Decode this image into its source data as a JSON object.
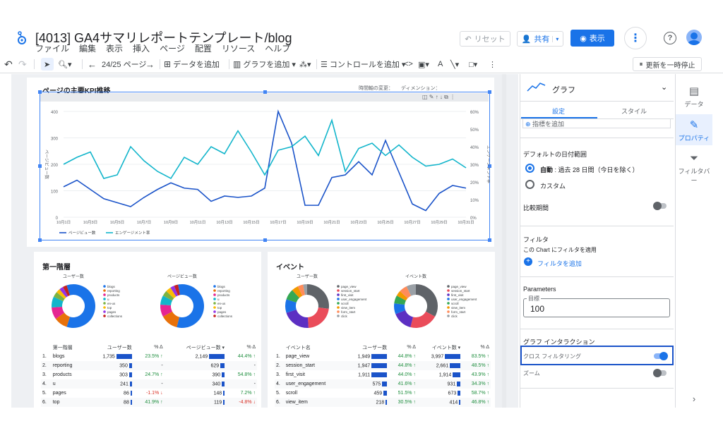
{
  "header": {
    "title": "[4013] GA4サマリレポートテンプレート/blog",
    "menu": [
      "ファイル",
      "編集",
      "表示",
      "挿入",
      "ページ",
      "配置",
      "リソース",
      "ヘルプ"
    ],
    "reset_label": "リセット",
    "share_label": "共有",
    "view_label": "表示"
  },
  "toolbar": {
    "page_indicator": "24/25 ページ",
    "add_data": "データを追加",
    "add_chart": "グラフを追加",
    "control": "コントロールを追加",
    "pause": "更新を一時停止"
  },
  "kpi_chart": {
    "title": "ページの主要KPI推移",
    "date_axis_label": "時間軸の変更：",
    "dimension_label": "ディメンション：",
    "left_axis_label": "ページビュー数",
    "right_axis_label": "エンゲージメント率",
    "legend": [
      "ページビュー数",
      "エンゲージメント率"
    ],
    "colors": {
      "pageviews": "#1a53c9",
      "engagement": "#12b5cb"
    }
  },
  "chart_data": {
    "type": "line",
    "x": [
      "10月1日",
      "10月2日",
      "10月3日",
      "10月4日",
      "10月5日",
      "10月6日",
      "10月7日",
      "10月8日",
      "10月9日",
      "10月10日",
      "10月11日",
      "10月12日",
      "10月13日",
      "10月14日",
      "10月15日",
      "10月16日",
      "10月17日",
      "10月18日",
      "10月19日",
      "10月20日",
      "10月21日",
      "10月22日",
      "10月23日",
      "10月24日",
      "10月25日",
      "10月26日",
      "10月27日",
      "10月28日",
      "10月29日",
      "10月30日",
      "10月31日"
    ],
    "x_ticks": [
      "10月1日",
      "10月3日",
      "10月5日",
      "10月7日",
      "10月9日",
      "10月11日",
      "10月13日",
      "10月15日",
      "10月17日",
      "10月19日",
      "10月21日",
      "10月23日",
      "10月25日",
      "10月27日",
      "10月29日",
      "10月31日"
    ],
    "series": [
      {
        "name": "ページビュー数",
        "axis": "left",
        "values": [
          115,
          140,
          105,
          70,
          55,
          40,
          75,
          105,
          130,
          110,
          105,
          60,
          80,
          75,
          80,
          110,
          400,
          280,
          45,
          45,
          150,
          160,
          210,
          160,
          290,
          170,
          50,
          25,
          90,
          120,
          110
        ]
      },
      {
        "name": "エンゲージメント率",
        "axis": "right",
        "values": [
          0.3,
          0.34,
          0.37,
          0.22,
          0.24,
          0.4,
          0.32,
          0.26,
          0.22,
          0.34,
          0.3,
          0.4,
          0.36,
          0.49,
          0.37,
          0.24,
          0.38,
          0.4,
          0.46,
          0.35,
          0.55,
          0.26,
          0.39,
          0.42,
          0.35,
          0.41,
          0.34,
          0.29,
          0.3,
          0.33,
          0.28
        ]
      }
    ],
    "ylim_left": [
      0,
      400
    ],
    "ylim_right": [
      0,
      0.6
    ],
    "left_ticks": [
      "0",
      "100",
      "200",
      "300",
      "400"
    ],
    "right_ticks": [
      "0%",
      "10%",
      "20%",
      "30%",
      "40%",
      "50%",
      "60%"
    ]
  },
  "layer_card": {
    "title": "第一階層",
    "donut1_title": "ユーザー数",
    "donut2_title": "ページビュー数",
    "legend": [
      "blogs",
      "reporting",
      "products",
      "u",
      "en-us",
      "top",
      "pages",
      "collections"
    ],
    "legend_colors": [
      "#1a73e8",
      "#e8710a",
      "#e52592",
      "#12b5cb",
      "#7cb342",
      "#fbbc04",
      "#9334e6",
      "#c5221f"
    ],
    "columns": [
      "第一階層",
      "ユーザー数",
      "% Δ",
      "ページビュー数 ▾",
      "% Δ"
    ],
    "rows": [
      {
        "n": "1.",
        "name": "blogs",
        "users": "1,735",
        "bar1": 1.0,
        "d1": "23.5% ↑",
        "pv": "2,149",
        "bar2": 1.0,
        "d2": "44.4% ↑"
      },
      {
        "n": "2.",
        "name": "reporting",
        "users": "350",
        "bar1": 0.2,
        "d1": "-",
        "pv": "629",
        "bar2": 0.29,
        "d2": "-"
      },
      {
        "n": "3.",
        "name": "products",
        "users": "303",
        "bar1": 0.17,
        "d1": "24.7% ↑",
        "pv": "390",
        "bar2": 0.18,
        "d2": "54.8% ↑"
      },
      {
        "n": "4.",
        "name": "u",
        "users": "241",
        "bar1": 0.14,
        "d1": "-",
        "pv": "340",
        "bar2": 0.16,
        "d2": "-"
      },
      {
        "n": "5.",
        "name": "pages",
        "users": "86",
        "bar1": 0.05,
        "d1": "-1.1% ↓",
        "pv": "148",
        "bar2": 0.07,
        "d2": "7.2% ↑"
      },
      {
        "n": "6.",
        "name": "top",
        "users": "88",
        "bar1": 0.05,
        "d1": "41.9% ↑",
        "pv": "119",
        "bar2": 0.06,
        "d2": "-4.8% ↓"
      }
    ]
  },
  "event_card": {
    "title": "イベント",
    "donut1_title": "ユーザー数",
    "donut2_title": "イベント数",
    "legend": [
      "page_view",
      "session_start",
      "first_visit",
      "user_engagement",
      "scroll",
      "view_item",
      "form_start",
      "click"
    ],
    "legend_colors": [
      "#5f6368",
      "#ea4c5a",
      "#5c2fc2",
      "#1a73e8",
      "#34a853",
      "#f29900",
      "#ff8c5a",
      "#9aa0a6"
    ],
    "columns": [
      "イベント名",
      "ユーザー数",
      "% Δ",
      "イベント数 ▾",
      "% Δ"
    ],
    "rows": [
      {
        "n": "1.",
        "name": "page_view",
        "users": "1,949",
        "bar1": 1.0,
        "d1": "44.8% ↑",
        "pv": "3,997",
        "bar2": 1.0,
        "d2": "83.5% ↑"
      },
      {
        "n": "2.",
        "name": "session_start",
        "users": "1,947",
        "bar1": 1.0,
        "d1": "44.8% ↑",
        "pv": "2,661",
        "bar2": 0.67,
        "d2": "48.5% ↑"
      },
      {
        "n": "3.",
        "name": "first_visit",
        "users": "1,911",
        "bar1": 0.98,
        "d1": "44.0% ↑",
        "pv": "1,914",
        "bar2": 0.48,
        "d2": "43.9% ↑"
      },
      {
        "n": "4.",
        "name": "user_engagement",
        "users": "575",
        "bar1": 0.3,
        "d1": "41.6% ↑",
        "pv": "931",
        "bar2": 0.23,
        "d2": "34.3% ↑"
      },
      {
        "n": "5.",
        "name": "scroll",
        "users": "459",
        "bar1": 0.24,
        "d1": "51.5% ↑",
        "pv": "673",
        "bar2": 0.17,
        "d2": "58.7% ↑"
      },
      {
        "n": "6.",
        "name": "view_item",
        "users": "218",
        "bar1": 0.11,
        "d1": "30.5% ↑",
        "pv": "414",
        "bar2": 0.1,
        "d2": "46.8% ↑"
      }
    ]
  },
  "panel": {
    "chart_type": "グラフ",
    "tab_setup": "設定",
    "tab_style": "スタイル",
    "add_metric": "指標を追加",
    "date_range_title": "デフォルトの日付範囲",
    "auto_label": "自動",
    "auto_desc": "過去 28 日間（今日を除く）",
    "custom_label": "カスタム",
    "compare_label": "比較期間",
    "filter_title": "フィルタ",
    "filter_desc": "この Chart にフィルタを適用",
    "add_filter": "フィルタを追加",
    "params_title": "Parameters",
    "param_name": "目標",
    "param_value": "100",
    "interaction_title": "グラフ インタラクション",
    "cross_filter": "クロス フィルタリング",
    "zoom": "ズーム"
  },
  "rail": {
    "data": "データ",
    "properties": "プロパティ",
    "filter_bar": "フィルタバー"
  }
}
